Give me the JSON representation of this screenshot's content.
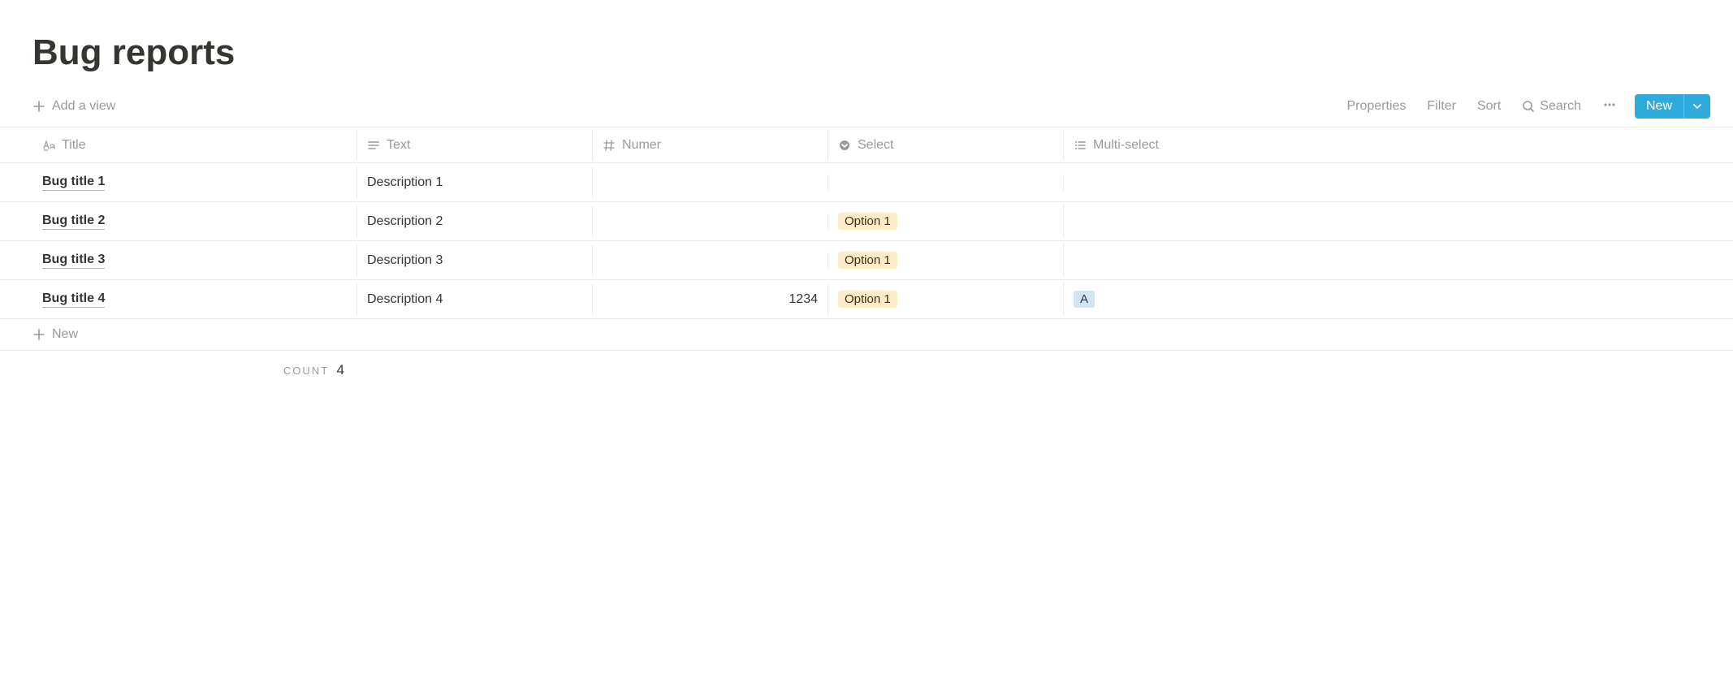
{
  "page_title": "Bug reports",
  "toolbar": {
    "add_view": "Add a view",
    "properties": "Properties",
    "filter": "Filter",
    "sort": "Sort",
    "search": "Search",
    "new_btn": "New"
  },
  "columns": {
    "title": "Title",
    "text": "Text",
    "number": "Numer",
    "select": "Select",
    "multiselect": "Multi-select"
  },
  "rows": [
    {
      "title": "Bug title 1",
      "text": "Description 1",
      "number": "",
      "select": "",
      "multi": ""
    },
    {
      "title": "Bug title 2",
      "text": "Description 2",
      "number": "",
      "select": "Option 1",
      "multi": ""
    },
    {
      "title": "Bug title 3",
      "text": "Description 3",
      "number": "",
      "select": "Option 1",
      "multi": ""
    },
    {
      "title": "Bug title 4",
      "text": "Description 4",
      "number": "1234",
      "select": "Option 1",
      "multi": "A"
    }
  ],
  "new_row": "New",
  "count": {
    "label": "COUNT",
    "value": "4"
  }
}
